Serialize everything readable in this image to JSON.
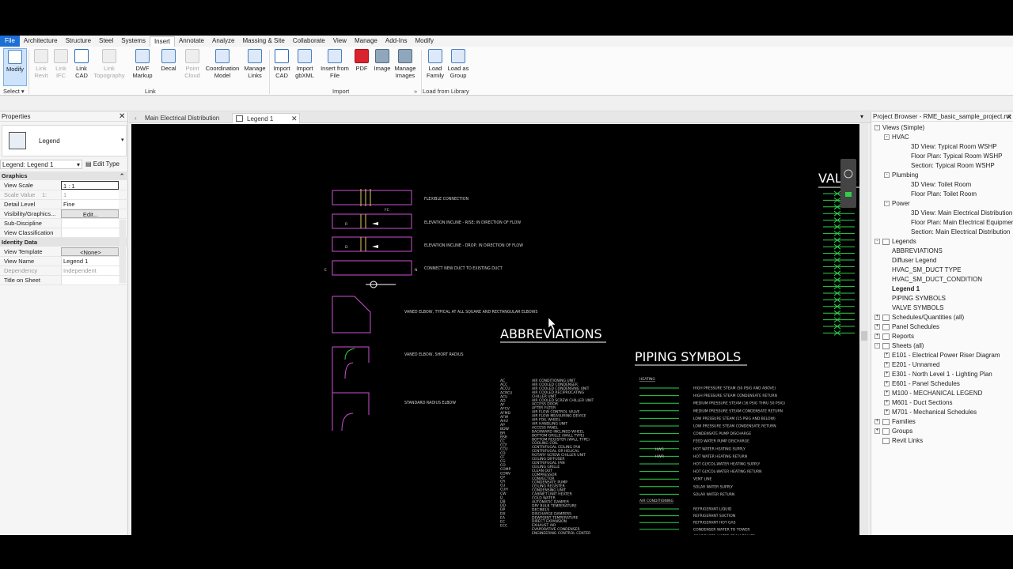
{
  "menu": [
    "File",
    "Architecture",
    "Structure",
    "Steel",
    "Systems",
    "Insert",
    "Annotate",
    "Analyze",
    "Massing & Site",
    "Collaborate",
    "View",
    "Manage",
    "Add-Ins",
    "Modify"
  ],
  "tools": {
    "modify": "Modify",
    "link_revit": "Link Revit",
    "link_ifc": "Link IFC",
    "link_cad": "Link CAD",
    "link_topography": "Link Topography",
    "dwf_markup": "DWF Markup",
    "decal": "Decal",
    "point_cloud": "Point Cloud",
    "coordination_model": "Coordination Model",
    "manage_links": "Manage Links",
    "import_cad": "Import CAD",
    "import_gbxml": "Import gbXML",
    "insert_from_file": "Insert from File",
    "pdf": "PDF",
    "image": "Image",
    "manage_images": "Manage Images",
    "load_family": "Load Family",
    "load_as_group": "Load as Group"
  },
  "panels": {
    "select": "Select ▾",
    "link": "Link",
    "import": "Import",
    "load_from_library": "Load from Library"
  },
  "properties": {
    "title": "Properties",
    "type_name": "Legend",
    "instance": "Legend: Legend 1",
    "edit_type": "Edit Type",
    "groups": {
      "graphics": "Graphics",
      "identity": "Identity Data"
    },
    "rows": [
      {
        "k": "View Scale",
        "v": "1 : 1"
      },
      {
        "k": "Scale Value",
        "v": "1"
      },
      {
        "k": "Detail Level",
        "v": "Fine"
      },
      {
        "k": "Visibility/Graphics...",
        "v": "Edit..."
      },
      {
        "k": "Sub-Discipline",
        "v": ""
      },
      {
        "k": "View Classification",
        "v": ""
      },
      {
        "k": "View Template",
        "v": "<None>"
      },
      {
        "k": "View Name",
        "v": "Legend 1"
      },
      {
        "k": "Dependency",
        "v": "Independent"
      },
      {
        "k": "Title on Sheet",
        "v": ""
      }
    ],
    "scale_value_label": "1:"
  },
  "view_tabs": [
    "Main Electrical Distribution",
    "Legend 1"
  ],
  "browser": {
    "title": "Project Browser - RME_basic_sample_project.rvt",
    "nodes": [
      {
        "t": "Views (Simple)",
        "l": 0,
        "tw": "-"
      },
      {
        "t": "HVAC",
        "l": 1,
        "tw": "-"
      },
      {
        "t": "3D View: Typical Room WSHP",
        "l": 2
      },
      {
        "t": "Floor Plan: Typical Room WSHP",
        "l": 2
      },
      {
        "t": "Section: Typical Room WSHP",
        "l": 2
      },
      {
        "t": "Plumbing",
        "l": 1,
        "tw": "-"
      },
      {
        "t": "3D View: Toilet Room",
        "l": 2
      },
      {
        "t": "Floor Plan: Toilet Room",
        "l": 2
      },
      {
        "t": "Power",
        "l": 1,
        "tw": "-"
      },
      {
        "t": "3D View: Main Electrical Distribution",
        "l": 2
      },
      {
        "t": "Floor Plan: Main Electrical Equipment",
        "l": 2
      },
      {
        "t": "Section: Main Electrical Distribution",
        "l": 2
      },
      {
        "t": "Legends",
        "l": 0,
        "tw": "-",
        "ic": true
      },
      {
        "t": "ABBREVIATIONS",
        "l": 1
      },
      {
        "t": "Diffuser Legend",
        "l": 1
      },
      {
        "t": "HVAC_SM_DUCT TYPE",
        "l": 1
      },
      {
        "t": "HVAC_SM_DUCT_CONDITION",
        "l": 1
      },
      {
        "t": "Legend 1",
        "l": 1,
        "b": true
      },
      {
        "t": "PIPING SYMBOLS",
        "l": 1
      },
      {
        "t": "VALVE SYMBOLS",
        "l": 1
      },
      {
        "t": "Schedules/Quantities (all)",
        "l": 0,
        "tw": "+",
        "ic": true
      },
      {
        "t": "Panel Schedules",
        "l": 0,
        "tw": "+",
        "ic": true
      },
      {
        "t": "Reports",
        "l": 0,
        "tw": "+",
        "ic": true
      },
      {
        "t": "Sheets (all)",
        "l": 0,
        "tw": "-",
        "ic": true
      },
      {
        "t": "E101 - Electrical Power Riser Diagram",
        "l": 1,
        "tw": "+"
      },
      {
        "t": "E201 - Unnamed",
        "l": 1,
        "tw": "+"
      },
      {
        "t": "E301 - North Level 1 - Lighting Plan",
        "l": 1,
        "tw": "+"
      },
      {
        "t": "E601 - Panel Schedules",
        "l": 1,
        "tw": "+"
      },
      {
        "t": "M100 - MECHANICAL LEGEND",
        "l": 1,
        "tw": "+"
      },
      {
        "t": "M601 - Duct Sections",
        "l": 1,
        "tw": "+"
      },
      {
        "t": "M701 - Mechanical Schedules",
        "l": 1,
        "tw": "+"
      },
      {
        "t": "Families",
        "l": 0,
        "tw": "+",
        "ic": true
      },
      {
        "t": "Groups",
        "l": 0,
        "tw": "+",
        "ic": true
      },
      {
        "t": "Revit Links",
        "l": 0,
        "ic": true
      }
    ]
  },
  "drawing": {
    "valve_title": "VALVE",
    "abbr_title": "ABBREVIATIONS",
    "piping_title": "PIPING SYMBOLS",
    "duct_notes": [
      "FLEXIBLE CONNECTION",
      "ELEVATION INCLINE - RISE; IN DIRECTION OF FLOW",
      "ELEVATION INCLINE - DROP; IN DIRECTION OF FLOW",
      "CONNECT NEW DUCT TO EXISTING DUCT",
      "VANED ELBOW, TYPICAL AT ALL SQUARE AND RECTANGULAR ELBOWS",
      "VANED ELBOW, SHORT RADIUS",
      "STANDARD RADIUS ELBOW"
    ],
    "abbr_codes": [
      "AC",
      "ACC",
      "ACCU",
      "ACRCU",
      "ACU",
      "AD",
      "AF",
      "AFCV",
      "AFMD",
      "AFW",
      "AHU",
      "AP",
      "BDW",
      "BR",
      "BSR",
      "CC",
      "CCF",
      "CCU",
      "CD",
      "CF",
      "CG",
      "CO",
      "COMP",
      "CONV",
      "CP",
      "CR",
      "CU",
      "CUH",
      "CW",
      "D",
      "DB",
      "DD",
      "DP",
      "DX",
      "EA",
      "EC",
      "ECC"
    ],
    "abbr_defs": [
      "AIR CONDITIONING UNIT",
      "AIR COOLED CONDENSER",
      "AIR COOLED CONDENSING UNIT",
      "AIR COOLED RECIPROCATING",
      "CHILLER UNIT",
      "AIR COOLED SCREW CHILLER UNIT",
      "ACCESS DOOR",
      "AFTER FILTER",
      "AIR FLOW CONTROL VALVE",
      "AIR FLOW MEASURING DEVICE",
      "AIR FOIL WHEEL",
      "AIR HANDLING UNIT",
      "ACCESS PANEL",
      "BACKWARD INCLINED WHEEL",
      "BOTTOM GRILLE (WALL TYPE)",
      "BOTTOM REGISTER (WALL TYPE)",
      "COOLING COIL",
      "CENTRIFUGAL CEILING FAN",
      "CENTRIFUGAL OR HELICAL",
      "ROTARY SCREW CHILLER UNIT",
      "CEILING DIFFUSER",
      "CENTRIFUGAL FAN",
      "CEILING GRILLE",
      "CLEAN OUT",
      "COMPRESSOR",
      "CONVECTOR",
      "CONDENSATE PUMP",
      "CEILING REGISTER",
      "CONDENSING UNIT",
      "CABINET UNIT HEATER",
      "COLD WATER",
      "AUTOMATIC DAMPER",
      "DRY BULB TEMPERATURE",
      "DECIBELS",
      "DISCHARGE DAMPERS",
      "DEWPOINT TEMPERATURE",
      "DIRECT EXPANSION",
      "EXHAUST AIR",
      "EVAPORATIVE CONDENSER",
      "ENGINEERING CONTROL CENTER"
    ],
    "pipe_section_heating": "HEATING",
    "pipe_section_ac": "AIR CONDITIONING",
    "pipe_tags": [
      "HWS",
      "HWR"
    ],
    "pipe_labels": [
      "HIGH PRESSURE STEAM (50 PSIG AND ABOVE)",
      "HIGH PRESSURE STEAM CONDENSATE RETURN",
      "MEDIUM PRESSURE STEAM (16 PSIG THRU 50 PSIG)",
      "MEDIUM PRESSURE STEAM CONDENSATE RETURN",
      "LOW PRESSURE STEAM (15 PSIG AND BELOW)",
      "LOW PRESSURE STEAM CONDENSATE RETURN",
      "CONDENSATE PUMP DISCHARGE",
      "FEED WATER PUMP DISCHARGE",
      "HOT WATER HEATING SUPPLY",
      "HOT WATER HEATING RETURN",
      "HOT GLYCOL-WATER HEATING SUPPLY",
      "HOT GLYCOL-WATER HEATING RETURN",
      "VENT LINE",
      "SOLAR WATER SUPPLY",
      "SOLAR WATER RETURN"
    ],
    "ac_labels": [
      "REFRIGERANT LIQUID",
      "REFRIGERANT SUCTION",
      "REFRIGERANT HOT GAS",
      "CONDENSER WATER TO TOWER",
      "CONDENSER WATER FROM TOWER"
    ],
    "tag_n": "N",
    "tag_e": "E",
    "tag_r": "R",
    "tag_d": "D",
    "tag_fc": "FC"
  }
}
